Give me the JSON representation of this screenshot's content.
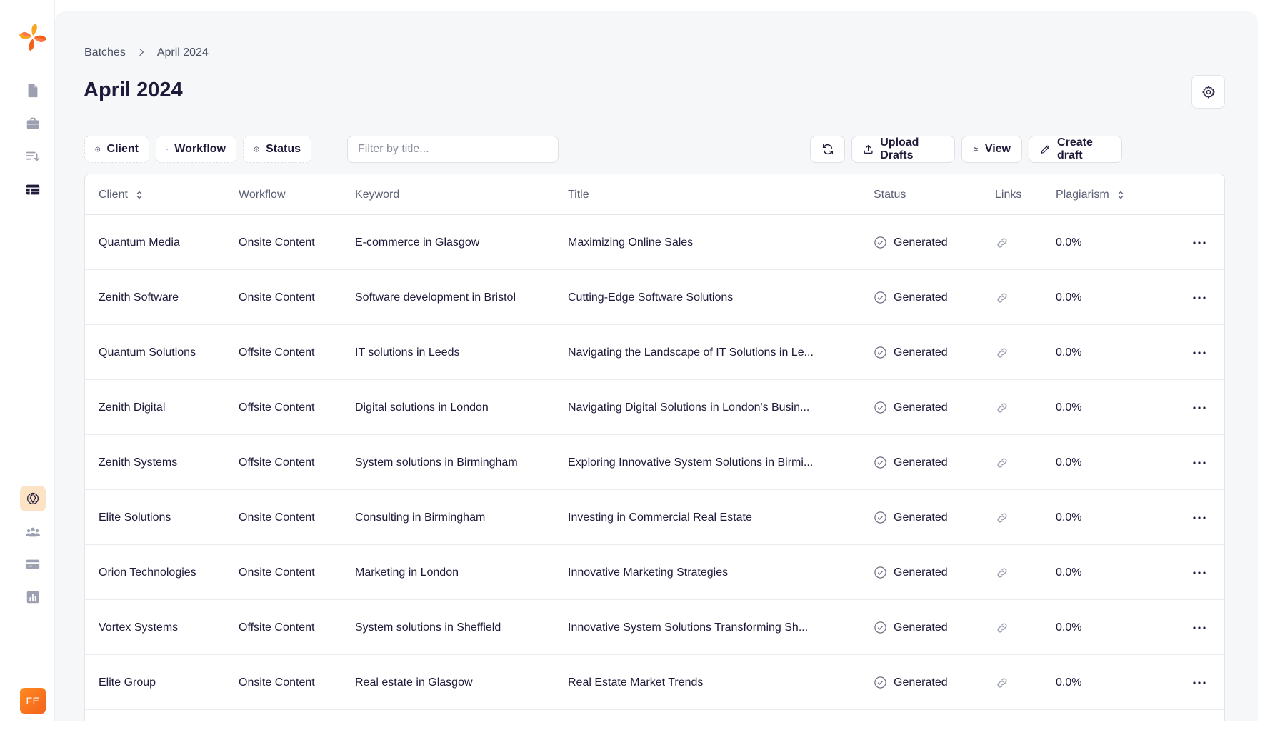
{
  "sidebar": {
    "nav_icons": [
      "document-icon",
      "briefcase-icon",
      "sort-list-icon",
      "table-icon"
    ],
    "bottom_icons": [
      "openai-icon",
      "users-icon",
      "credit-card-icon",
      "bar-chart-icon"
    ],
    "avatar_initials": "FE"
  },
  "breadcrumb": {
    "root": "Batches",
    "current": "April 2024"
  },
  "page": {
    "title": "April 2024"
  },
  "toolbar": {
    "filters": [
      "Client",
      "Workflow",
      "Status"
    ],
    "search_placeholder": "Filter by title...",
    "search_value": "",
    "upload_label": "Upload Drafts",
    "view_label": "View",
    "create_label": "Create draft"
  },
  "table": {
    "columns": {
      "client": "Client",
      "workflow": "Workflow",
      "keyword": "Keyword",
      "title": "Title",
      "status": "Status",
      "links": "Links",
      "plagiarism": "Plagiarism"
    },
    "rows": [
      {
        "client": "Quantum Media",
        "workflow": "Onsite Content",
        "keyword": "E-commerce in Glasgow",
        "title": "Maximizing Online Sales",
        "status": "Generated",
        "plagiarism": "0.0%"
      },
      {
        "client": "Zenith Software",
        "workflow": "Onsite Content",
        "keyword": "Software development in Bristol",
        "title": "Cutting-Edge Software Solutions",
        "status": "Generated",
        "plagiarism": "0.0%"
      },
      {
        "client": "Quantum Solutions",
        "workflow": "Offsite Content",
        "keyword": "IT solutions in Leeds",
        "title": "Navigating the Landscape of IT Solutions in Le...",
        "status": "Generated",
        "plagiarism": "0.0%"
      },
      {
        "client": "Zenith Digital",
        "workflow": "Offsite Content",
        "keyword": "Digital solutions in London",
        "title": "Navigating Digital Solutions in London's Busin...",
        "status": "Generated",
        "plagiarism": "0.0%"
      },
      {
        "client": "Zenith Systems",
        "workflow": "Offsite Content",
        "keyword": "System solutions in Birmingham",
        "title": "Exploring Innovative System Solutions in Birmi...",
        "status": "Generated",
        "plagiarism": "0.0%"
      },
      {
        "client": "Elite Solutions",
        "workflow": "Onsite Content",
        "keyword": "Consulting in Birmingham",
        "title": "Investing in Commercial Real Estate",
        "status": "Generated",
        "plagiarism": "0.0%"
      },
      {
        "client": "Orion Technologies",
        "workflow": "Onsite Content",
        "keyword": "Marketing in London",
        "title": "Innovative Marketing Strategies",
        "status": "Generated",
        "plagiarism": "0.0%"
      },
      {
        "client": "Vortex Systems",
        "workflow": "Offsite Content",
        "keyword": "System solutions in Sheffield",
        "title": "Innovative System Solutions Transforming Sh...",
        "status": "Generated",
        "plagiarism": "0.0%"
      },
      {
        "client": "Elite Group",
        "workflow": "Onsite Content",
        "keyword": "Real estate in Glasgow",
        "title": "Real Estate Market Trends",
        "status": "Generated",
        "plagiarism": "0.0%"
      }
    ]
  },
  "colors": {
    "accent_orange": "#f3621d",
    "text_primary": "#1e1b3a",
    "panel_bg": "#f6f7f9"
  }
}
